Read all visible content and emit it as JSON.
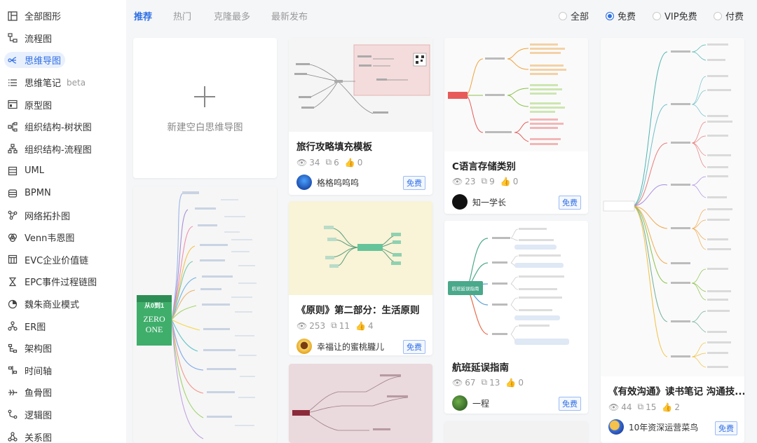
{
  "sidebar": {
    "items": [
      {
        "label": "全部图形",
        "icon": "all-shapes-icon"
      },
      {
        "label": "流程图",
        "icon": "flowchart-icon"
      },
      {
        "label": "思维导图",
        "icon": "mindmap-icon",
        "active": true
      },
      {
        "label": "思维笔记",
        "icon": "notes-list-icon",
        "tag": "beta"
      },
      {
        "label": "原型图",
        "icon": "prototype-icon"
      },
      {
        "label": "组织结构-树状图",
        "icon": "org-tree-icon"
      },
      {
        "label": "组织结构-流程图",
        "icon": "org-flow-icon"
      },
      {
        "label": "UML",
        "icon": "uml-icon"
      },
      {
        "label": "BPMN",
        "icon": "bpmn-icon"
      },
      {
        "label": "网络拓扑图",
        "icon": "network-icon"
      },
      {
        "label": "Venn韦恩图",
        "icon": "venn-icon"
      },
      {
        "label": "EVC企业价值链",
        "icon": "evc-icon"
      },
      {
        "label": "EPC事件过程链图",
        "icon": "epc-icon"
      },
      {
        "label": "魏朱商业模式",
        "icon": "business-model-icon"
      },
      {
        "label": "ER图",
        "icon": "er-icon"
      },
      {
        "label": "架构图",
        "icon": "architecture-icon"
      },
      {
        "label": "时间轴",
        "icon": "timeline-icon"
      },
      {
        "label": "鱼骨图",
        "icon": "fishbone-icon"
      },
      {
        "label": "逻辑图",
        "icon": "logic-icon"
      },
      {
        "label": "关系图",
        "icon": "relation-icon"
      }
    ]
  },
  "tabs": [
    {
      "label": "推荐",
      "active": true
    },
    {
      "label": "热门"
    },
    {
      "label": "克隆最多"
    },
    {
      "label": "最新发布"
    }
  ],
  "price_filter": [
    {
      "label": "全部",
      "checked": false
    },
    {
      "label": "免费",
      "checked": true
    },
    {
      "label": "VIP免费",
      "checked": false
    },
    {
      "label": "付费",
      "checked": false
    }
  ],
  "new_card": {
    "label": "新建空白思维导图"
  },
  "cards": [
    {
      "title": "旅行攻略填充模板",
      "views": "34",
      "clones": "6",
      "likes": "0",
      "author": "格格呜呜呜",
      "badge": "免费"
    },
    {
      "title": "C语言存储类别",
      "views": "23",
      "clones": "9",
      "likes": "0",
      "author": "知一学长",
      "badge": "免费"
    },
    {
      "title": "《有效沟通》读书笔记 沟通技...",
      "views": "44",
      "clones": "15",
      "likes": "2",
      "author": "10年资深运营菜鸟",
      "badge": "免费"
    },
    {
      "title": "《原则》第二部分：生活原则",
      "views": "253",
      "clones": "11",
      "likes": "4",
      "author": "幸福让的蜜桃朧儿",
      "badge": "免费"
    },
    {
      "title": "航班延误指南",
      "views": "67",
      "clones": "13",
      "likes": "0",
      "author": "一程",
      "badge": "免费"
    }
  ],
  "thumbnails": {
    "zero_one_book": {
      "line1": "从0到1",
      "line2": "ZERO",
      "line3": "ONE"
    },
    "flight_center": "航班延误指南"
  },
  "colors": {
    "accent": "#2f6fe4"
  }
}
